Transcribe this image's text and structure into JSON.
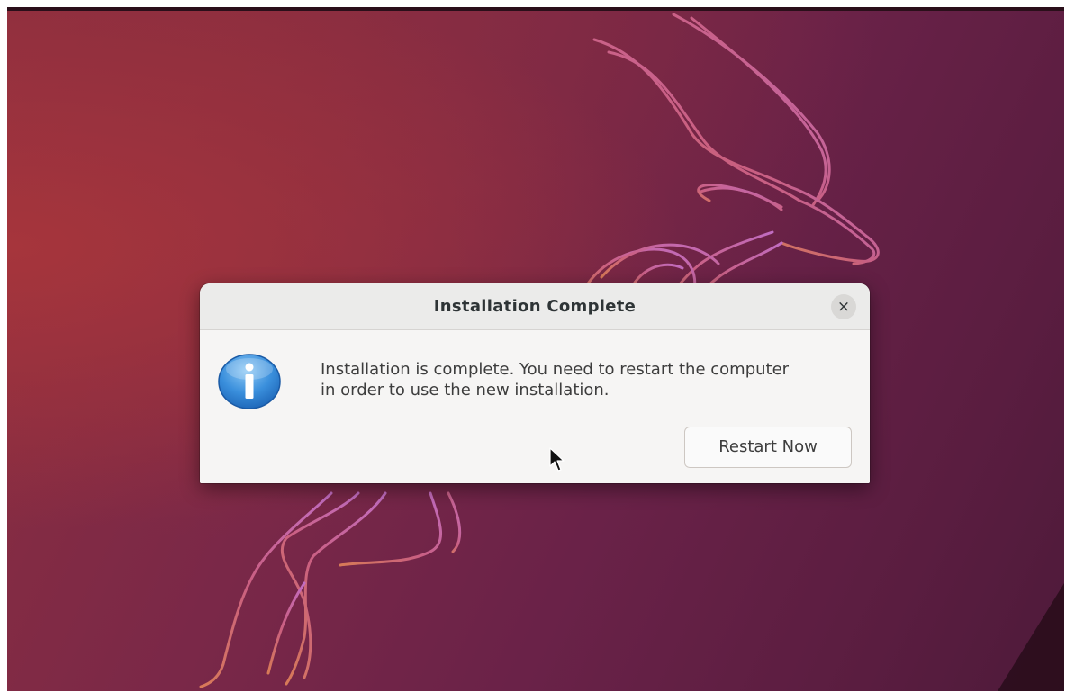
{
  "dialog": {
    "title": "Installation Complete",
    "close_glyph": "×",
    "close_icon": "close-icon",
    "info_icon": "info-icon",
    "message_line1": "Installation is complete. You need to restart the computer",
    "message_line2": "in order to use the new installation.",
    "restart_label": "Restart Now"
  },
  "desktop": {
    "wallpaper_icon": "ubuntu-kudu-mascot-outline",
    "pointer_icon": "mouse-pointer-icon"
  },
  "colors": {
    "wallpaper_red": "#a6353c",
    "wallpaper_purple": "#5a1d40",
    "mascot_pink": "#e07ab8",
    "mascot_orange": "#e8895a",
    "info_blue": "#2e86d8",
    "dialog_bg": "#f6f5f4",
    "titlebar_bg": "#ebebea"
  }
}
